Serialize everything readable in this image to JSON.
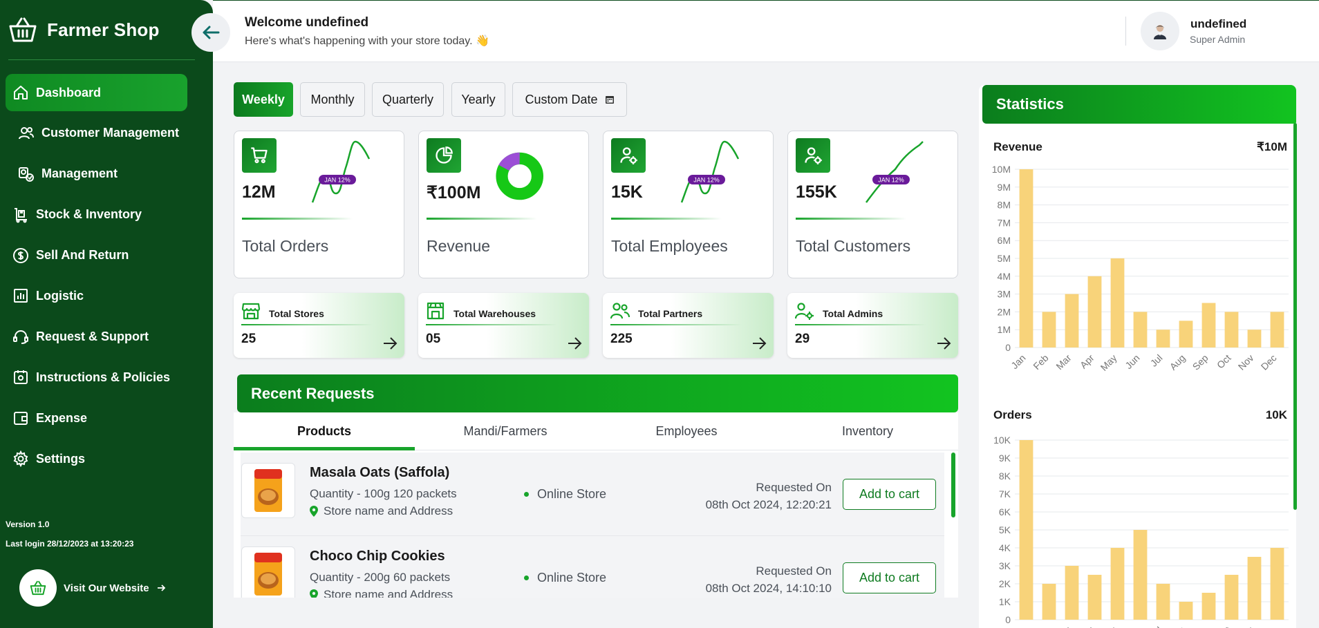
{
  "brand": {
    "name": "Farmer Shop"
  },
  "sidebar": {
    "items": [
      {
        "label": "Dashboard",
        "icon": "home-icon"
      },
      {
        "label": "Customer Management",
        "icon": "users-icon"
      },
      {
        "label": "Management",
        "icon": "management-icon"
      },
      {
        "label": "Stock & Inventory",
        "icon": "inventory-icon"
      },
      {
        "label": "Sell And Return",
        "icon": "dollar-icon"
      },
      {
        "label": "Logistic",
        "icon": "chart-icon"
      },
      {
        "label": "Request & Support",
        "icon": "headset-icon"
      },
      {
        "label": "Instructions & Policies",
        "icon": "policy-icon"
      },
      {
        "label": "Expense",
        "icon": "wallet-icon"
      },
      {
        "label": "Settings",
        "icon": "gear-icon"
      }
    ],
    "version": "Version 1.0",
    "last_login": "Last login 28/12/2023 at 13:20:23",
    "visit_label": "Visit Our Website"
  },
  "header": {
    "welcome": "Welcome undefined",
    "subtitle": "Here's what's happening with your store today. 👋",
    "user_name": "undefined",
    "user_role": "Super Admin"
  },
  "periods": [
    "Weekly",
    "Monthly",
    "Quarterly",
    "Yearly",
    "Custom Date"
  ],
  "kpis": [
    {
      "value": "12M",
      "label": "Total Orders",
      "badge": "JAN 12%"
    },
    {
      "value": "₹100M",
      "label": "Revenue"
    },
    {
      "value": "15K",
      "label": "Total Employees",
      "badge": "JAN 12%"
    },
    {
      "value": "155K",
      "label": "Total Customers",
      "badge": "JAN 12%"
    }
  ],
  "mini_stats": [
    {
      "label": "Total Stores",
      "value": "25"
    },
    {
      "label": "Total Warehouses",
      "value": "05"
    },
    {
      "label": "Total Partners",
      "value": "225"
    },
    {
      "label": "Total Admins",
      "value": "29"
    }
  ],
  "recent": {
    "title": "Recent Requests",
    "tabs": [
      "Products",
      "Mandi/Farmers",
      "Employees",
      "Inventory"
    ],
    "rows": [
      {
        "name": "Masala Oats (Saffola)",
        "qty": "Quantity - 100g 120 packets",
        "address": "Store name and Address",
        "store": "Online Store",
        "requested_label": "Requested On",
        "requested_on": "08th Oct 2024, 12:20:21",
        "action": "Add to cart"
      },
      {
        "name": "Choco Chip Cookies",
        "qty": "Quantity - 200g 60 packets",
        "address": "Store name and Address",
        "store": "Online Store",
        "requested_label": "Requested On",
        "requested_on": "08th Oct 2024, 14:10:10",
        "action": "Add to cart"
      }
    ]
  },
  "statistics": {
    "title": "Statistics",
    "accent": "#18a42b",
    "bar_color": "#f8d37a"
  },
  "chart_data": [
    {
      "type": "bar",
      "title": "Revenue",
      "max_label": "₹10M",
      "categories": [
        "Jan",
        "Feb",
        "Mar",
        "Apr",
        "May",
        "Jun",
        "Jul",
        "Aug",
        "Sep",
        "Oct",
        "Nov",
        "Dec"
      ],
      "values": [
        10,
        2,
        3,
        4,
        5,
        2,
        1,
        1.5,
        2.5,
        2,
        1,
        2
      ],
      "yticks": [
        "0",
        "1M",
        "2M",
        "3M",
        "4M",
        "5M",
        "6M",
        "7M",
        "8M",
        "9M",
        "10M"
      ],
      "ylim": [
        0,
        10
      ]
    },
    {
      "type": "bar",
      "title": "Orders",
      "max_label": "10K",
      "categories": [
        "Jan",
        "Feb",
        "Mar",
        "Apr",
        "May",
        "Jun",
        "Jul",
        "Aug",
        "Sep",
        "Oct",
        "Nov",
        "Dec"
      ],
      "values": [
        10,
        2,
        3,
        2.5,
        4,
        5,
        2,
        1,
        1.5,
        2.5,
        3.5,
        4
      ],
      "yticks": [
        "0",
        "1K",
        "2K",
        "3K",
        "4K",
        "5K",
        "6K",
        "7K",
        "8K",
        "9K",
        "10K"
      ],
      "ylim": [
        0,
        10
      ]
    }
  ]
}
